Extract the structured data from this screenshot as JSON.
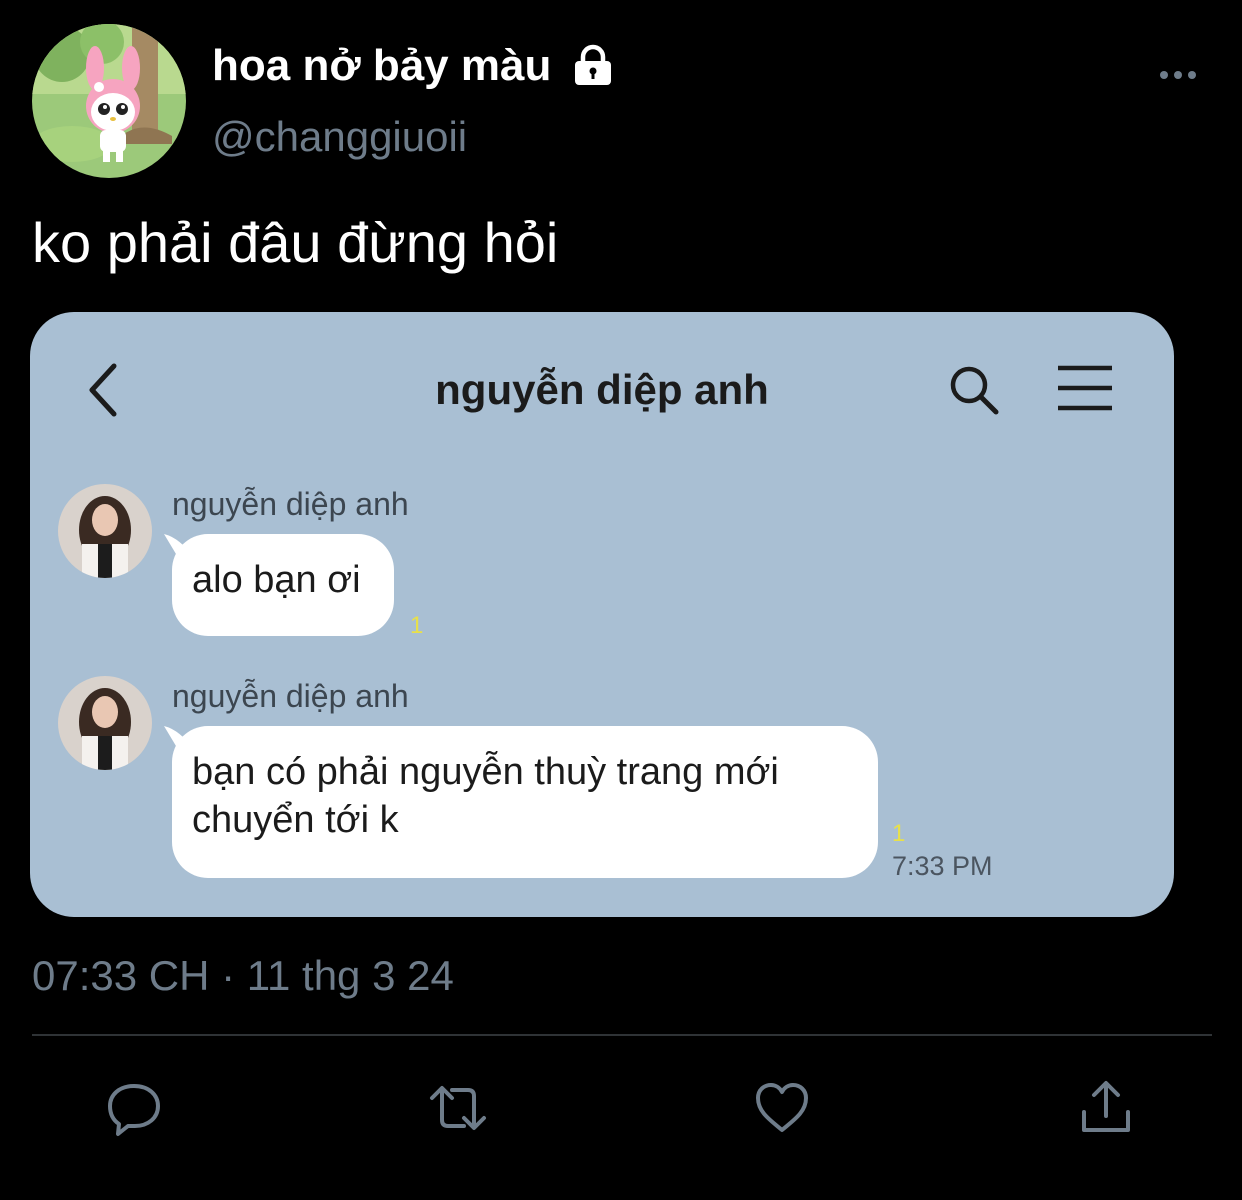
{
  "tweet": {
    "display_name": "hoa nở bảy màu",
    "handle": "@changgiuoii",
    "text": "ko phải đâu đừng hỏi",
    "timestamp": "07:33 CH · 11 thg 3 24",
    "icons": {
      "protected": "lock-icon",
      "more": "more-dots-icon"
    }
  },
  "media": {
    "chat_title": "nguyễn diệp anh",
    "messages": [
      {
        "sender": "nguyễn diệp anh",
        "lines": [
          "alo bạn ơi"
        ],
        "read_count": "1"
      },
      {
        "sender": "nguyễn diệp anh",
        "lines": [
          "bạn có phải nguyễn thuỳ trang mới",
          "chuyển tới k"
        ],
        "read_count": "1",
        "time": "7:33 PM"
      }
    ],
    "colors": {
      "background": "#a9bfd3",
      "bubble": "#ffffff",
      "read_count": "#e8e04a"
    }
  },
  "actions": [
    "reply-icon",
    "retweet-icon",
    "like-icon",
    "share-icon"
  ],
  "colors": {
    "background": "#000000",
    "secondary_text": "#6e7c8a",
    "divider": "#2f3336"
  }
}
